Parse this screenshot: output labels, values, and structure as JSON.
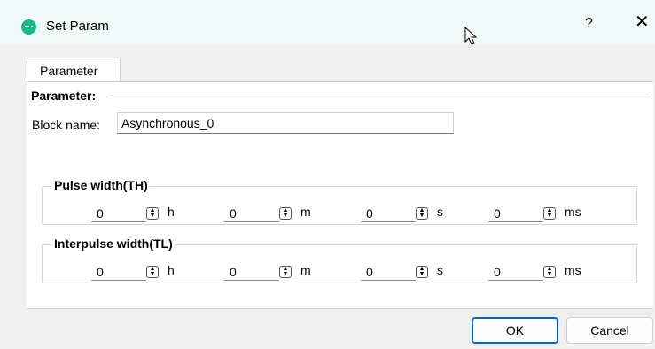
{
  "window": {
    "title": "Set Param",
    "help": "?",
    "close": "✕"
  },
  "tabs": [
    {
      "label": "Parameter"
    }
  ],
  "section": {
    "title": "Parameter:"
  },
  "block": {
    "label": "Block name:",
    "value": "Asynchronous_0"
  },
  "groups": [
    {
      "title": "Pulse width(TH)",
      "fields": [
        {
          "value": "0",
          "unit": "h"
        },
        {
          "value": "0",
          "unit": "m"
        },
        {
          "value": "0",
          "unit": "s"
        },
        {
          "value": "0",
          "unit": "ms"
        }
      ]
    },
    {
      "title": "Interpulse width(TL)",
      "fields": [
        {
          "value": "0",
          "unit": "h"
        },
        {
          "value": "0",
          "unit": "m"
        },
        {
          "value": "0",
          "unit": "s"
        },
        {
          "value": "0",
          "unit": "ms"
        }
      ]
    }
  ],
  "buttons": {
    "ok": "OK",
    "cancel": "Cancel"
  },
  "colors": {
    "accent": "#0067c0",
    "app_icon": "#12b98a",
    "titlebar": "#f0f9f7"
  }
}
